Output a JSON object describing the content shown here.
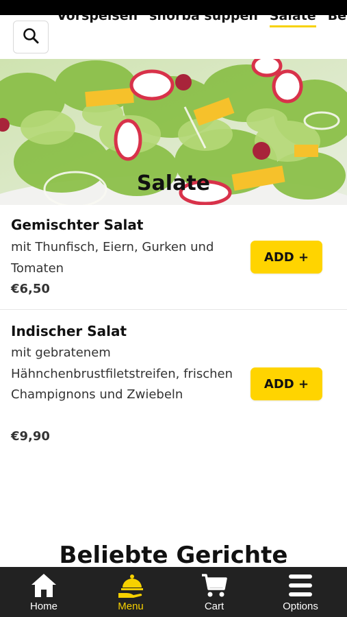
{
  "categories": {
    "items": [
      "Vorspeisen",
      "shorba suppen",
      "Salate",
      "Beil"
    ],
    "active_index": 2
  },
  "search": {
    "icon": "search-icon"
  },
  "hero": {
    "title": "Salate"
  },
  "menu_items": [
    {
      "name": "Gemischter Salat",
      "description": "mit Thunfisch, Eiern, Gurken und Tomaten",
      "price": "€6,50",
      "add_label": "ADD +"
    },
    {
      "name": "Indischer Salat",
      "description": "mit gebratenem Hähnchenbrustfiletstreifen, frischen Champignons und Zwiebeln",
      "price": "€9,90",
      "add_label": "ADD +"
    }
  ],
  "popular": {
    "title": "Beliebte Gerichte"
  },
  "bottom_nav": [
    {
      "label": "Home",
      "icon": "home-icon"
    },
    {
      "label": "Menu",
      "icon": "cloche-icon"
    },
    {
      "label": "Cart",
      "icon": "cart-icon"
    },
    {
      "label": "Options",
      "icon": "hamburger-menu-icon"
    }
  ],
  "colors": {
    "accent": "#ffd400",
    "nav_active": "#f7d100",
    "nav_bg": "#222222"
  }
}
